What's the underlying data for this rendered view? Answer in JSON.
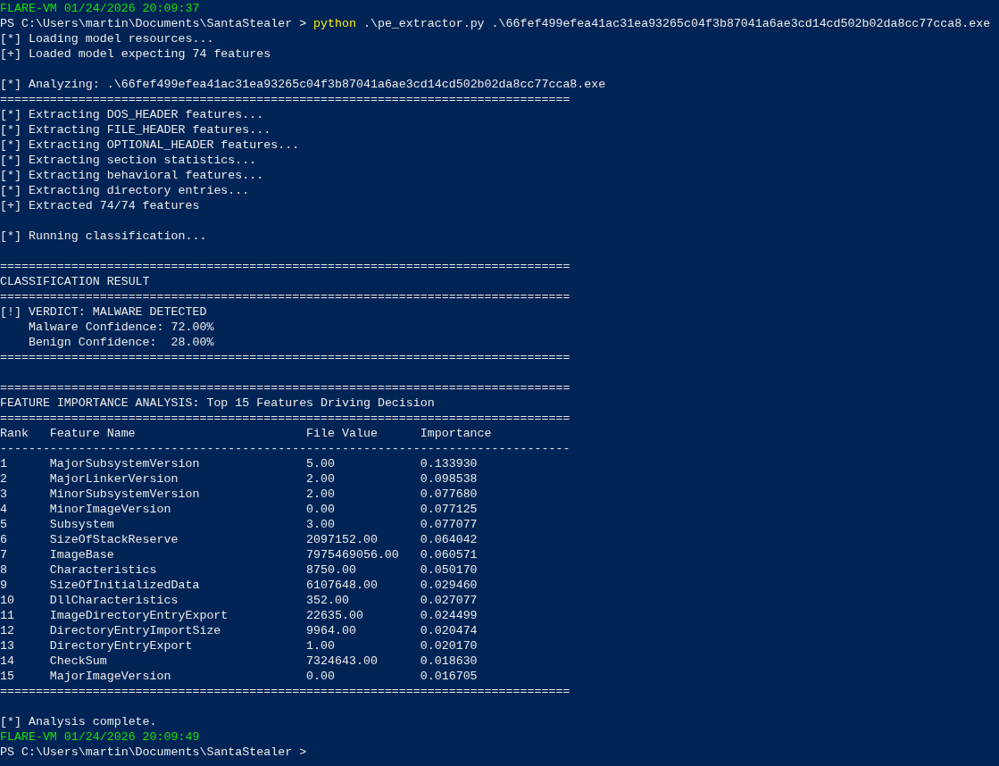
{
  "lines": [
    {
      "kind": "timestamp",
      "text": "FLARE-VM 01/24/2026 20:09:37"
    },
    {
      "kind": "command",
      "prompt": "PS C:\\Users\\martin\\Documents\\SantaStealer >",
      "command": "python",
      "args": ".\\pe_extractor.py .\\66fef499efea41ac31ea93265c04f3b87041a6ae3cd14cd502b02da8cc77cca8.exe"
    },
    {
      "kind": "text",
      "text": "[*] Loading model resources..."
    },
    {
      "kind": "text",
      "text": "[+] Loaded model expecting 74 features"
    },
    {
      "kind": "blank"
    },
    {
      "kind": "text",
      "text": "[*] Analyzing: .\\66fef499efea41ac31ea93265c04f3b87041a6ae3cd14cd502b02da8cc77cca8.exe"
    },
    {
      "kind": "rule",
      "text": "================================================================================"
    },
    {
      "kind": "text",
      "text": "[*] Extracting DOS_HEADER features..."
    },
    {
      "kind": "text",
      "text": "[*] Extracting FILE_HEADER features..."
    },
    {
      "kind": "text",
      "text": "[*] Extracting OPTIONAL_HEADER features..."
    },
    {
      "kind": "text",
      "text": "[*] Extracting section statistics..."
    },
    {
      "kind": "text",
      "text": "[*] Extracting behavioral features..."
    },
    {
      "kind": "text",
      "text": "[*] Extracting directory entries..."
    },
    {
      "kind": "text",
      "text": "[+] Extracted 74/74 features"
    },
    {
      "kind": "blank"
    },
    {
      "kind": "text",
      "text": "[*] Running classification..."
    },
    {
      "kind": "blank"
    },
    {
      "kind": "rule",
      "text": "================================================================================"
    },
    {
      "kind": "text",
      "text": "CLASSIFICATION RESULT"
    },
    {
      "kind": "rule",
      "text": "================================================================================"
    },
    {
      "kind": "text",
      "text": "[!] VERDICT: MALWARE DETECTED"
    },
    {
      "kind": "indented",
      "text": "Malware Confidence: 72.00%"
    },
    {
      "kind": "indented",
      "text": "Benign Confidence:  28.00%"
    },
    {
      "kind": "rule",
      "text": "================================================================================"
    },
    {
      "kind": "blank"
    },
    {
      "kind": "rule",
      "text": "================================================================================"
    },
    {
      "kind": "text",
      "text": "FEATURE IMPORTANCE ANALYSIS: Top 15 Features Driving Decision"
    },
    {
      "kind": "rule",
      "text": "================================================================================"
    },
    {
      "kind": "table_header",
      "cells": [
        "Rank",
        "Feature Name",
        "File Value",
        "Importance"
      ]
    },
    {
      "kind": "rule",
      "text": "--------------------------------------------------------------------------------"
    },
    {
      "kind": "table_row",
      "cells": [
        "1",
        "MajorSubsystemVersion",
        "5.00",
        "0.133930"
      ]
    },
    {
      "kind": "table_row",
      "cells": [
        "2",
        "MajorLinkerVersion",
        "2.00",
        "0.098538"
      ]
    },
    {
      "kind": "table_row",
      "cells": [
        "3",
        "MinorSubsystemVersion",
        "2.00",
        "0.077680"
      ]
    },
    {
      "kind": "table_row",
      "cells": [
        "4",
        "MinorImageVersion",
        "0.00",
        "0.077125"
      ]
    },
    {
      "kind": "table_row",
      "cells": [
        "5",
        "Subsystem",
        "3.00",
        "0.077077"
      ]
    },
    {
      "kind": "table_row",
      "cells": [
        "6",
        "SizeOfStackReserve",
        "2097152.00",
        "0.064042"
      ]
    },
    {
      "kind": "table_row",
      "cells": [
        "7",
        "ImageBase",
        "7975469056.00",
        "0.060571"
      ]
    },
    {
      "kind": "table_row",
      "cells": [
        "8",
        "Characteristics",
        "8750.00",
        "0.050170"
      ]
    },
    {
      "kind": "table_row",
      "cells": [
        "9",
        "SizeOfInitializedData",
        "6107648.00",
        "0.029460"
      ]
    },
    {
      "kind": "table_row",
      "cells": [
        "10",
        "DllCharacteristics",
        "352.00",
        "0.027077"
      ]
    },
    {
      "kind": "table_row",
      "cells": [
        "11",
        "ImageDirectoryEntryExport",
        "22635.00",
        "0.024499"
      ]
    },
    {
      "kind": "table_row",
      "cells": [
        "12",
        "DirectoryEntryImportSize",
        "9964.00",
        "0.020474"
      ]
    },
    {
      "kind": "table_row",
      "cells": [
        "13",
        "DirectoryEntryExport",
        "1.00",
        "0.020170"
      ]
    },
    {
      "kind": "table_row",
      "cells": [
        "14",
        "CheckSum",
        "7324643.00",
        "0.018630"
      ]
    },
    {
      "kind": "table_row",
      "cells": [
        "15",
        "MajorImageVersion",
        "0.00",
        "0.016705"
      ]
    },
    {
      "kind": "rule",
      "text": "================================================================================"
    },
    {
      "kind": "blank"
    },
    {
      "kind": "text",
      "text": "[*] Analysis complete."
    },
    {
      "kind": "timestamp",
      "text": "FLARE-VM 01/24/2026 20:09:49"
    },
    {
      "kind": "prompt",
      "prompt": "PS C:\\Users\\martin\\Documents\\SantaStealer >"
    }
  ]
}
